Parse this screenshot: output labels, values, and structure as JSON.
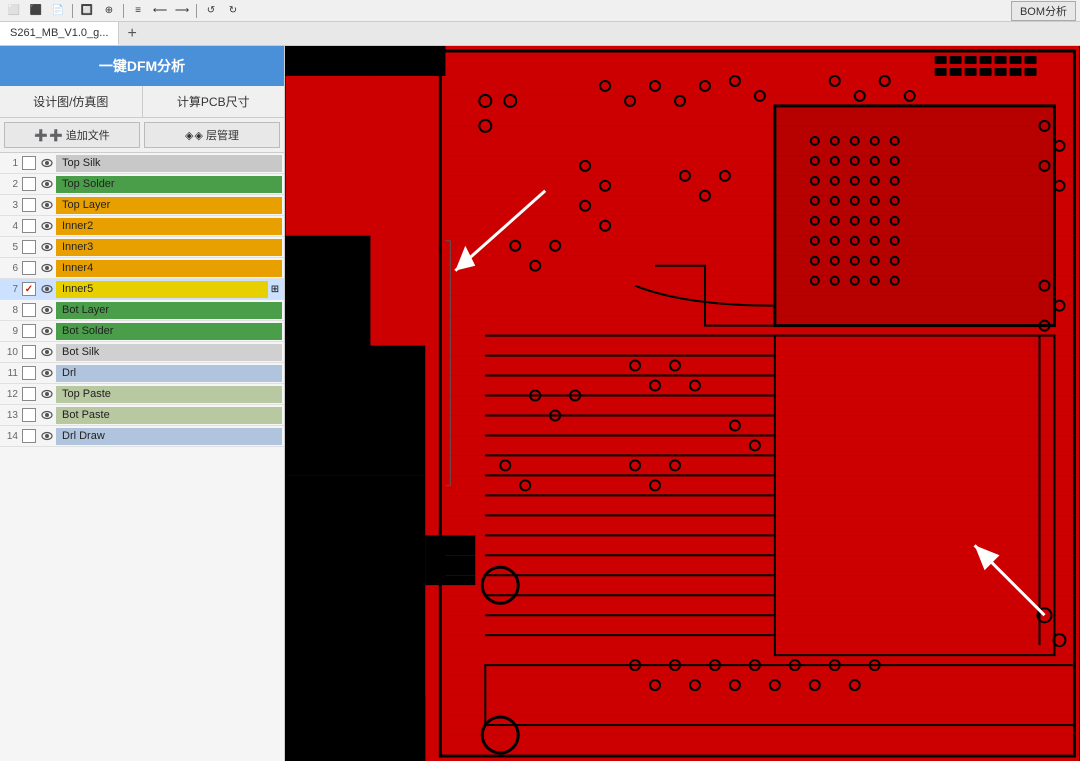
{
  "toolbar": {
    "bom_label": "BOM分析"
  },
  "tabs": [
    {
      "id": "tab1",
      "label": "S261_MB_V1.0_g...",
      "active": true
    },
    {
      "id": "tab-add",
      "label": "+"
    }
  ],
  "left_panel": {
    "dfm_title": "一键DFM分析",
    "btn_design": "设计图/仿真图",
    "btn_calc": "计算PCB尺寸",
    "btn_add_file": "➕ 追加文件",
    "btn_layer_mgmt": "◈ 层管理",
    "layers": [
      {
        "num": "1",
        "name": "Top Silk",
        "color": "#c8c8c8",
        "textColor": "#000",
        "checked": false,
        "eye": true,
        "selected": false
      },
      {
        "num": "2",
        "name": "Top Solder",
        "color": "#4a9e4a",
        "textColor": "#000",
        "checked": false,
        "eye": true,
        "selected": false
      },
      {
        "num": "3",
        "name": "Top Layer",
        "color": "#e8a000",
        "textColor": "#000",
        "checked": false,
        "eye": true,
        "selected": false
      },
      {
        "num": "4",
        "name": "Inner2",
        "color": "#e8a000",
        "textColor": "#000",
        "checked": false,
        "eye": true,
        "selected": false
      },
      {
        "num": "5",
        "name": "Inner3",
        "color": "#e8a000",
        "textColor": "#000",
        "checked": false,
        "eye": true,
        "selected": false
      },
      {
        "num": "6",
        "name": "Inner4",
        "color": "#e8a000",
        "textColor": "#000",
        "checked": false,
        "eye": true,
        "selected": false
      },
      {
        "num": "7",
        "name": "Inner5",
        "color": "#e8d000",
        "textColor": "#000",
        "checked": true,
        "eye": true,
        "selected": true,
        "expand": true
      },
      {
        "num": "8",
        "name": "Bot Layer",
        "color": "#4a9e4a",
        "textColor": "#000",
        "checked": false,
        "eye": true,
        "selected": false
      },
      {
        "num": "9",
        "name": "Bot Solder",
        "color": "#4a9e4a",
        "textColor": "#000",
        "checked": false,
        "eye": true,
        "selected": false
      },
      {
        "num": "10",
        "name": "Bot Silk",
        "color": "#d0d0d0",
        "textColor": "#000",
        "checked": false,
        "eye": true,
        "selected": false
      },
      {
        "num": "11",
        "name": "Drl",
        "color": "#b0c4de",
        "textColor": "#000",
        "checked": false,
        "eye": true,
        "selected": false
      },
      {
        "num": "12",
        "name": "Top Paste",
        "color": "#b8c8a0",
        "textColor": "#000",
        "checked": false,
        "eye": true,
        "selected": false
      },
      {
        "num": "13",
        "name": "Bot Paste",
        "color": "#b8c8a0",
        "textColor": "#000",
        "checked": false,
        "eye": true,
        "selected": false
      },
      {
        "num": "14",
        "name": "Drl Draw",
        "color": "#b0c4de",
        "textColor": "#000",
        "checked": false,
        "eye": true,
        "selected": false
      }
    ]
  },
  "icons": {
    "eye": "👁",
    "check": "✓",
    "plus": "+",
    "expand": "⊞",
    "add_file": "➕",
    "layer_mgmt": "◈"
  }
}
